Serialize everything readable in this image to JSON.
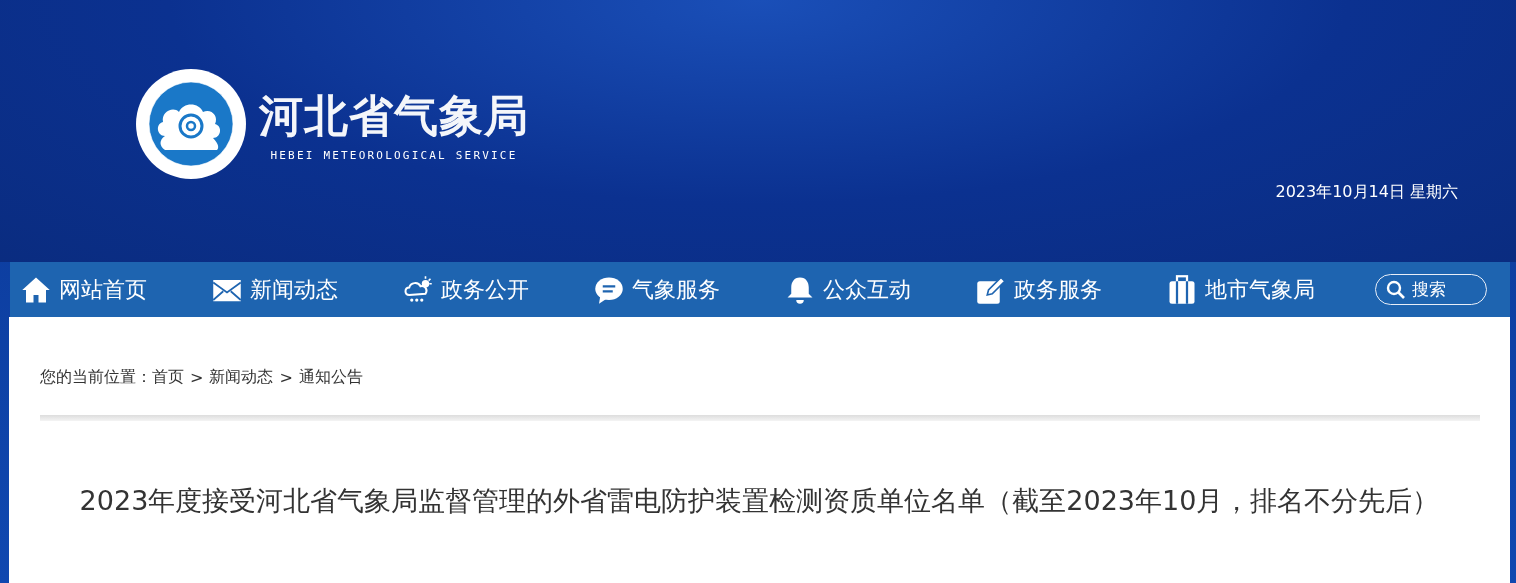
{
  "header": {
    "site_name": "河北省气象局",
    "site_name_en": "HEBEI METEOROLOGICAL SERVICE",
    "date": "2023年10月14日 星期六"
  },
  "nav": {
    "items": [
      {
        "label": "网站首页",
        "kind": "home"
      },
      {
        "label": "新闻动态",
        "kind": "mail"
      },
      {
        "label": "政务公开",
        "kind": "weather"
      },
      {
        "label": "气象服务",
        "kind": "chat"
      },
      {
        "label": "公众互动",
        "kind": "bell"
      },
      {
        "label": "政务服务",
        "kind": "edit"
      },
      {
        "label": "地市气象局",
        "kind": "case"
      }
    ],
    "search": {
      "label": "搜索"
    }
  },
  "breadcrumb": {
    "prefix": "您的当前位置：",
    "items": [
      "首页",
      "新闻动态",
      "通知公告"
    ],
    "separator": ">"
  },
  "article": {
    "title": "2023年度接受河北省气象局监督管理的外省雷电防护装置检测资质单位名单（截至2023年10月，排名不分先后）"
  }
}
